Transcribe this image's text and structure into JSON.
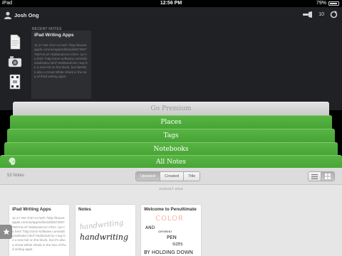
{
  "status_bar": {
    "device": "iPad",
    "time": "12:56 PM",
    "battery": "79%"
  },
  "header": {
    "user_name": "Josh Ong",
    "notification_count": "10"
  },
  "recent_notes": {
    "label": "RECENT NOTES",
    "items": [
      {
        "title": "iPad Writing Apps",
        "body": "11:17 AM <h3><a href=\"http://itunes.apple.com/us/app/editorial/id673907758?mt=8\">Editorial</a></h3> <p><a href=\"http://omz-software.com/editorial/index.html\">Editorial</a> may be a new kid on the block, but it&#39;s also a Great White Shark in the sea of iPad writing apps."
      }
    ]
  },
  "stack": {
    "premium": "Go Premium",
    "places": "Places",
    "tags": "Tags",
    "notebooks": "Notebooks",
    "all_notes": "All Notes"
  },
  "panel": {
    "notes_count": "53 Notes",
    "sort_options": [
      "Updated",
      "Created",
      "Title"
    ],
    "active_sort": "Updated",
    "month_header": "AUGUST 2013"
  },
  "cards": [
    {
      "title": "iPad Writing Apps",
      "body": "11:17 AM <h3><a href=\"http://itunes.apple.com/us/app/editorial/id673907758?mt=8\">Editorial</a></h3> <p><a href=\"http://omz-software.com/editorial/index.html\">Editorial</a> may be a new kid on the block, but it's also a Great White Shark in the sea of iPad writing apps."
    },
    {
      "title": "Notes",
      "handwriting": [
        "handwriting",
        "handwriting"
      ]
    },
    {
      "title": "Welcome to Penultimate",
      "handwriting": [
        "COLOR",
        "AND",
        "DIFFERENT",
        "PEN",
        "SIZES",
        "BY HOLDING DOWN"
      ]
    }
  ],
  "colors": {
    "green": "#47a634",
    "dark_bg": "#1f2125",
    "panel_bg": "#e6e6e6"
  }
}
